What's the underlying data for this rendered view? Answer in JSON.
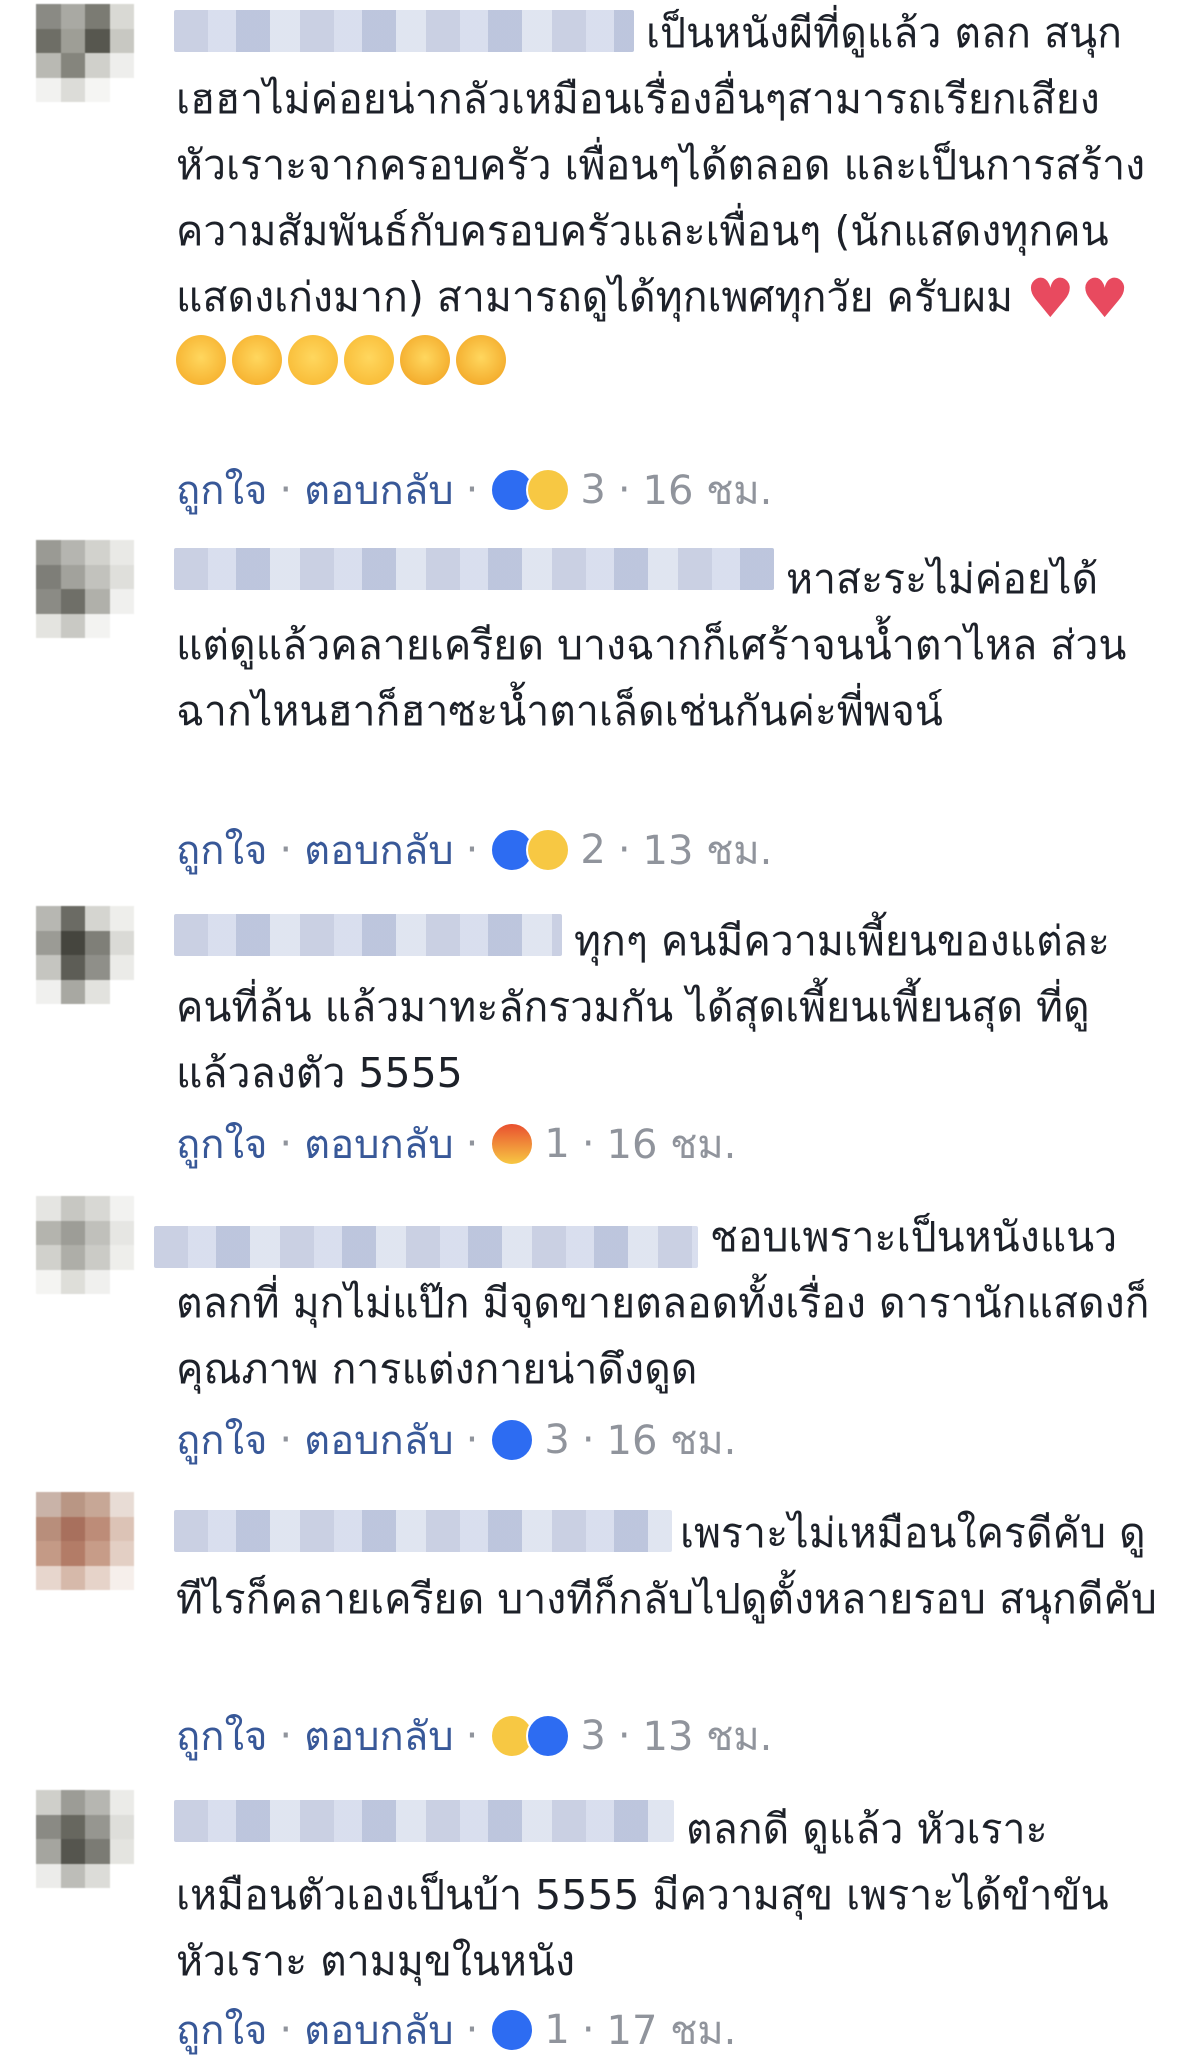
{
  "comments": [
    {
      "text": "เป็นหนังผีที่ดูแล้ว ตลก สนุก เฮฮาไม่ค่อยน่ากลัวเหมือนเรื่องอื่นๆสามารถเรียกเสียงหัวเราะจากครอบครัว เพื่อนๆได้ตลอด และเป็นการสร้างความสัมพันธ์กับครอบครัวและเพื่อนๆ (นักแสดงทุกคน แสดงเก่งมาก) สามารถดูได้ทุกเพศทุกวัย ครับผม",
      "emojis": [
        "heart",
        "heart",
        "laughing",
        "laughing",
        "smiling",
        "smiling",
        "star-struck",
        "star-struck"
      ],
      "like_label": "ถูกใจ",
      "reply_label": "ตอบกลับ",
      "reactions": [
        "like",
        "sad"
      ],
      "reaction_count": "3",
      "time": "16 ชม."
    },
    {
      "text": "หาสะระไม่ค่อยได้ แต่ดูแล้วคลายเครียด บางฉากก็เศร้าจนน้ำตาไหล ส่วนฉากไหนฮาก็ฮาซะน้ำตาเล็ดเช่นกันค่ะพี่พจน์",
      "like_label": "ถูกใจ",
      "reply_label": "ตอบกลับ",
      "reactions": [
        "like",
        "sad"
      ],
      "reaction_count": "2",
      "time": "13 ชม."
    },
    {
      "text": "ทุกๆ คนมีความเพี้ยนของแต่ละคนที่ล้น แล้วมาทะลักรวมกัน ได้สุดเพี้ยนเพี้ยนสุด ที่ดูแล้วลงตัว 5555",
      "like_label": "ถูกใจ",
      "reply_label": "ตอบกลับ",
      "reactions": [
        "angry"
      ],
      "reaction_count": "1",
      "time": "16 ชม."
    },
    {
      "text": "ชอบเพราะเป็นหนังแนวตลกที่ มุกไม่แป๊ก มีจุดขายตลอดทั้งเรื่อง ดารานักแสดงก็คุณภาพ การแต่งกายน่าดึงดูด",
      "like_label": "ถูกใจ",
      "reply_label": "ตอบกลับ",
      "reactions": [
        "like"
      ],
      "reaction_count": "3",
      "time": "16 ชม."
    },
    {
      "text": "เพราะไม่เหมือนใครดีคับ ดูทีไรก็คลายเครียด บางทีก็กลับไปดูตั้งหลายรอบ สนุกดีคับ",
      "like_label": "ถูกใจ",
      "reply_label": "ตอบกลับ",
      "reactions": [
        "sad",
        "like"
      ],
      "reaction_count": "3",
      "time": "13 ชม."
    },
    {
      "text": "ตลกดี ดูแล้ว หัวเราะเหมือนตัวเองเป็นบ้า 5555 มีความสุข เพราะได้ขำขัน หัวเราะ ตามมุขในหนัง",
      "like_label": "ถูกใจ",
      "reply_label": "ตอบกลับ",
      "reactions": [
        "like"
      ],
      "reaction_count": "1",
      "time": "17 ชม."
    }
  ],
  "colors": {
    "link": "#385898",
    "meta": "#90949c",
    "text": "#1d2129",
    "like": "#2d6cf2",
    "sad": "#f7c843",
    "angry": "#e9502f"
  }
}
